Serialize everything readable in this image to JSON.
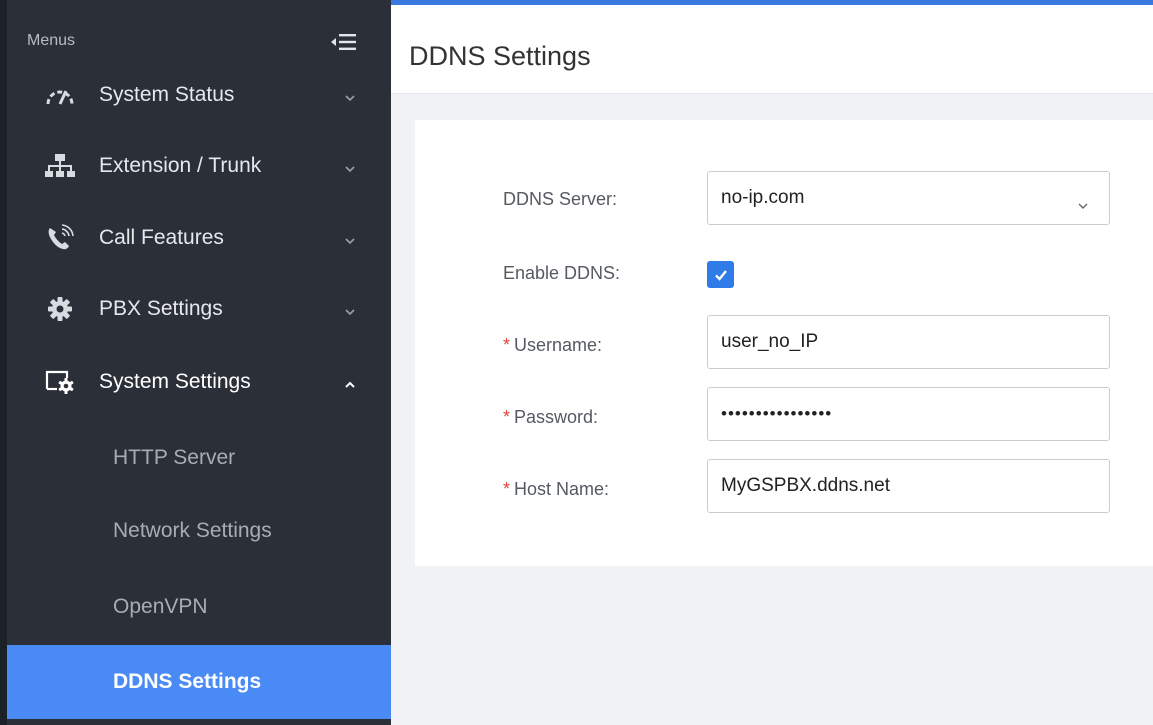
{
  "sidebar": {
    "menus_label": "Menus",
    "items": [
      {
        "label": "System Status",
        "icon": "speedometer-icon"
      },
      {
        "label": "Extension / Trunk",
        "icon": "network-icon"
      },
      {
        "label": "Call Features",
        "icon": "phone-icon"
      },
      {
        "label": "PBX Settings",
        "icon": "gear-icon"
      },
      {
        "label": "System Settings",
        "icon": "monitor-gear-icon"
      }
    ],
    "sub_items": [
      {
        "label": "HTTP Server"
      },
      {
        "label": "Network Settings"
      },
      {
        "label": "OpenVPN"
      },
      {
        "label": "DDNS Settings"
      }
    ]
  },
  "header": {
    "title": "DDNS Settings"
  },
  "form": {
    "ddns_server": {
      "label": "DDNS Server:",
      "value": "no-ip.com"
    },
    "enable_ddns": {
      "label": "Enable DDNS:",
      "checked": true
    },
    "username": {
      "required_mark": "*",
      "label": "Username:",
      "value": "user_no_IP"
    },
    "password": {
      "required_mark": "*",
      "label": "Password:",
      "value": "••••••••••••••••"
    },
    "host_name": {
      "required_mark": "*",
      "label": "Host Name:",
      "value": "MyGSPBX.ddns.net"
    }
  },
  "colors": {
    "sidebar_bg": "#2a2f38",
    "active_item": "#4a8af4",
    "accent": "#2f7ce8",
    "required": "#e0443c"
  }
}
